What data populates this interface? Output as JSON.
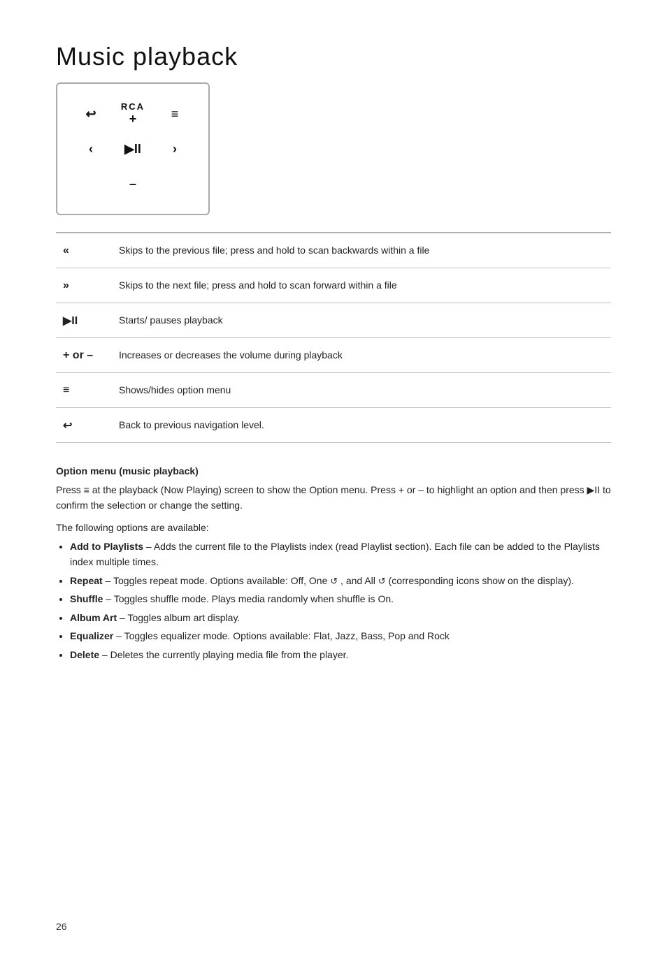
{
  "page": {
    "title": "Music playback",
    "page_number": "26"
  },
  "device": {
    "brand": "RCA",
    "buttons": {
      "back": "↩",
      "plus": "+",
      "menu": "≡",
      "prev": "«",
      "playpause": "▶II",
      "next": "»",
      "minus": "–"
    }
  },
  "controls": [
    {
      "symbol": "«",
      "description": "Skips to the previous file; press and hold to scan backwards within a file"
    },
    {
      "symbol": "»",
      "description": "Skips to the next file; press and hold to scan forward within a file"
    },
    {
      "symbol": "▶II",
      "description": "Starts/ pauses playback"
    },
    {
      "symbol": "+ or –",
      "description": "Increases or decreases the volume during playback"
    },
    {
      "symbol": "≡",
      "description": "Shows/hides option menu"
    },
    {
      "symbol": "↩",
      "description": "Back to previous navigation level."
    }
  ],
  "option_menu": {
    "title": "Option menu (music playback)",
    "intro": "Press ≡ at the playback (Now Playing) screen to show the Option menu. Press + or – to highlight an option and then press ▶II to confirm the selection or change the setting.",
    "available_label": "The following options are available:",
    "options": [
      {
        "name": "Add to Playlists",
        "description": " – Adds the current file to the Playlists index (read Playlist section).  Each file can be added to the Playlists index multiple times."
      },
      {
        "name": "Repeat",
        "description": " – Toggles repeat mode. Options available: Off, One 🔁 , and All 🔁  (corresponding icons show on the display)."
      },
      {
        "name": "Shuffle",
        "description": " – Toggles shuffle mode. Plays media randomly when shuffle is On."
      },
      {
        "name": "Album Art",
        "description": " – Toggles album art display."
      },
      {
        "name": "Equalizer",
        "description": " – Toggles equalizer mode. Options available: Flat, Jazz, Bass, Pop and Rock"
      },
      {
        "name": "Delete",
        "description": " – Deletes the currently playing media file from the player."
      }
    ]
  }
}
